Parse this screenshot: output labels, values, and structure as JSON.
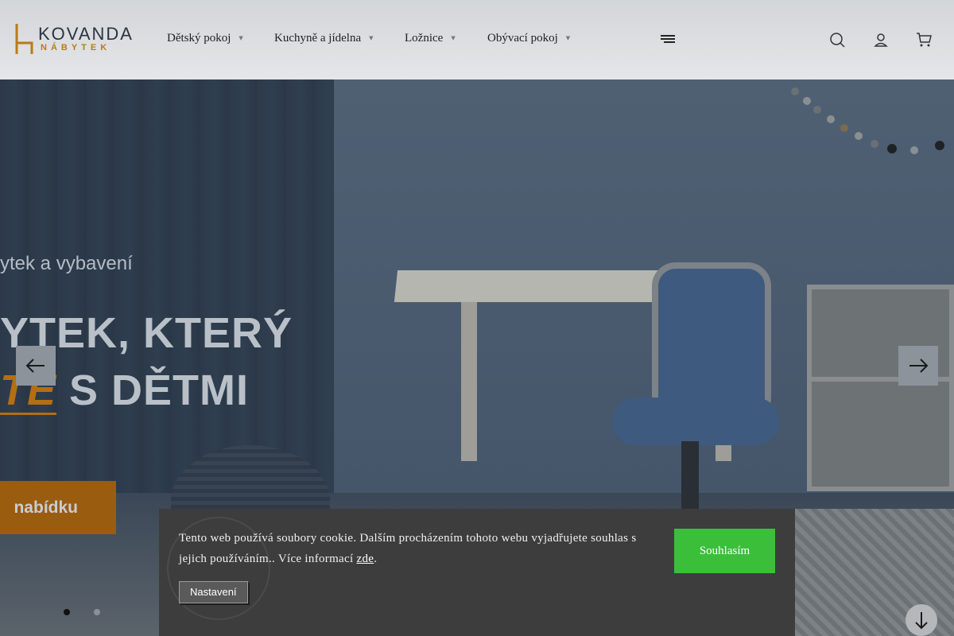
{
  "brand": {
    "name": "KOVANDA",
    "sub": "NÁBYTEK",
    "accent_color": "#b87b1a"
  },
  "nav": {
    "items": [
      {
        "label": "Dětský pokoj"
      },
      {
        "label": "Kuchyně a jídelna"
      },
      {
        "label": "Ložnice"
      },
      {
        "label": "Obývací pokoj"
      }
    ],
    "menu_icon": "hamburger-icon"
  },
  "header_icons": [
    "search-icon",
    "user-icon",
    "cart-icon"
  ],
  "hero": {
    "subtitle": "ytek a vybavení",
    "headline_line1": "YTEK, KTERÝ",
    "headline_line2_accent": "TE",
    "headline_line2_rest": " S DĚTMI",
    "cta_label": "nabídku",
    "prev_icon": "arrow-left-icon",
    "next_icon": "arrow-right-icon",
    "slides_count": 2,
    "active_slide": 1
  },
  "cookie": {
    "text_before_link": "Tento web používá soubory cookie. Dalším procházením tohoto webu vyjadřujete souhlas s jejich používáním.. Více informací ",
    "link_label": "zde",
    "text_after_link": ".",
    "settings_label": "Nastavení",
    "accept_label": "Souhlasím",
    "accept_color": "#3bbf3b"
  },
  "scroll_icon": "arrow-down-icon"
}
